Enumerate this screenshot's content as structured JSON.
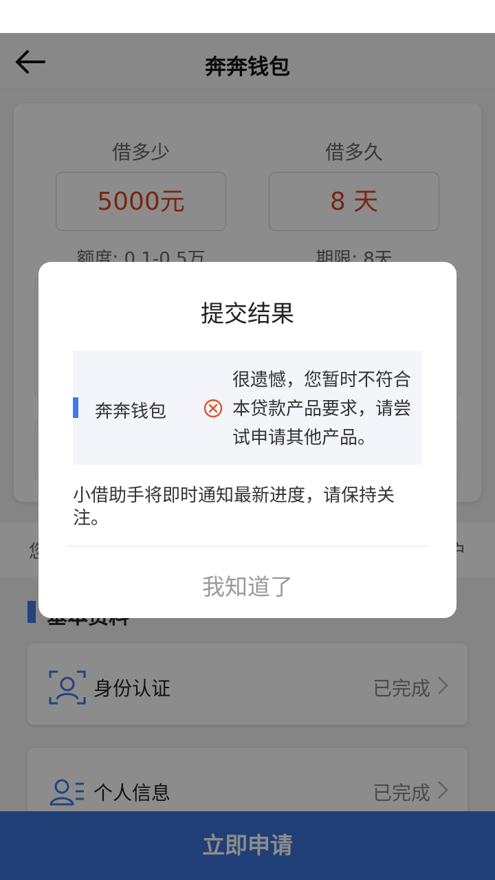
{
  "header": {
    "title": "奔奔钱包"
  },
  "loan": {
    "amount": {
      "label": "借多少",
      "value": "5000元",
      "note": "额度: 0.1-0.5万"
    },
    "term": {
      "label": "借多久",
      "value": "8 天",
      "note": "期限: 8天"
    }
  },
  "notice": {
    "left": "您",
    "right": "户"
  },
  "section": {
    "title": "基本资料"
  },
  "info_items": [
    {
      "label": "身份认证",
      "status": "已完成",
      "icon": "id-face-icon"
    },
    {
      "label": "个人信息",
      "status": "已完成",
      "icon": "person-list-icon"
    }
  ],
  "apply": {
    "label": "立即申请"
  },
  "dialog": {
    "title": "提交结果",
    "product": "奔奔钱包",
    "message": "很遗憾，您暂时不符合本贷款产品要求，请尝试申请其他产品。",
    "note": "小借助手将即时通知最新进度，请保持关注。",
    "ok": "我知道了"
  },
  "colors": {
    "accent": "#3d7ce8",
    "value": "#d9461e",
    "apply": "#3b73d8",
    "fail": "#e0522a"
  }
}
